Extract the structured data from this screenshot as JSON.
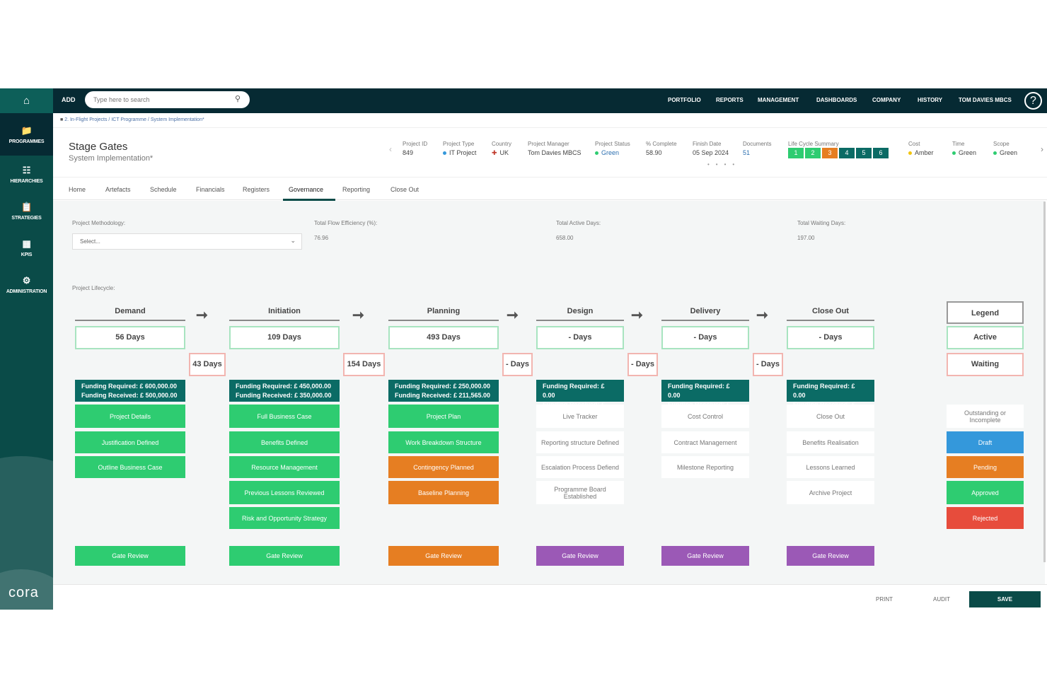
{
  "sidebar": {
    "home_icon": "home-icon",
    "logo": "cora",
    "items": [
      {
        "label": "PROGRAMMES",
        "icon": "folder-icon"
      },
      {
        "label": "HIERARCHIES",
        "icon": "hierarchy-icon"
      },
      {
        "label": "STRATEGIES",
        "icon": "clipboard-icon"
      },
      {
        "label": "KPIS",
        "icon": "bar-chart-icon"
      },
      {
        "label": "ADMINISTRATION",
        "icon": "gears-icon"
      }
    ]
  },
  "topbar": {
    "add": "ADD",
    "search_placeholder": "Type here to search",
    "nav": [
      "PORTFOLIO",
      "REPORTS",
      "MANAGEMENT",
      "DASHBOARDS",
      "COMPANY",
      "HISTORY",
      "TOM DAVIES MBCS"
    ],
    "help": "?"
  },
  "breadcrumb": "2. In-Flight Projects / ICT Programme / System Implementation*",
  "header": {
    "title": "Stage Gates",
    "subtitle": "System Implementation*"
  },
  "meta": [
    {
      "label": "Project ID",
      "value": "849"
    },
    {
      "label": "Project Type",
      "value": "IT Project",
      "dot": "#3498db"
    },
    {
      "label": "Country",
      "value": "UK",
      "flag": true
    },
    {
      "label": "Project Manager",
      "value": "Tom Davies MBCS"
    },
    {
      "label": "Project Status",
      "value": "Green",
      "dot": "#2ecc71"
    },
    {
      "label": "% Complete",
      "value": "58.90"
    },
    {
      "label": "Finish Date",
      "value": "05 Sep 2024"
    },
    {
      "label": "Documents",
      "value": "51"
    },
    {
      "label": "Life Cycle Summary",
      "lifecycle": [
        {
          "n": "1",
          "color": "#2ecc71"
        },
        {
          "n": "2",
          "color": "#2ecc71"
        },
        {
          "n": "3",
          "color": "#e67e22"
        },
        {
          "n": "4",
          "color": "#0b6b65"
        },
        {
          "n": "5",
          "color": "#0b6b65"
        },
        {
          "n": "6",
          "color": "#0b6b65"
        }
      ]
    },
    {
      "label": "Cost",
      "value": "Amber",
      "dot": "#f1c40f"
    },
    {
      "label": "Time",
      "value": "Green",
      "dot": "#2ecc71"
    },
    {
      "label": "Scope",
      "value": "Green",
      "dot": "#2ecc71"
    }
  ],
  "tabs": [
    "Home",
    "Artefacts",
    "Schedule",
    "Financials",
    "Registers",
    "Governance",
    "Reporting",
    "Close Out"
  ],
  "active_tab": "Governance",
  "fields": {
    "methodology_label": "Project Methodology:",
    "methodology_value": "Select...",
    "flow_label": "Total Flow Efficiency (%):",
    "flow_value": "76.96",
    "active_label": "Total Active Days:",
    "active_value": "658.00",
    "waiting_label": "Total Waiting Days:",
    "waiting_value": "197.00",
    "lifecycle_label": "Project Lifecycle:"
  },
  "stages": [
    {
      "name": "Demand",
      "days": "56 Days",
      "wait": "43 Days",
      "funding_required": "Funding Required: £ 600,000.00",
      "funding_received": "Funding Received: £ 500,000.00",
      "items": [
        {
          "label": "Project Details",
          "status": "g"
        },
        {
          "label": "Justification Defined",
          "status": "g"
        },
        {
          "label": "Outline Business Case",
          "status": "g"
        }
      ],
      "gate": {
        "label": "Gate Review",
        "status": "g"
      }
    },
    {
      "name": "Initiation",
      "days": "109 Days",
      "wait": "154 Days",
      "funding_required": "Funding Required: £ 450,000.00",
      "funding_received": "Funding Received: £ 350,000.00",
      "items": [
        {
          "label": "Full Business Case",
          "status": "g"
        },
        {
          "label": "Benefits Defined",
          "status": "g"
        },
        {
          "label": "Resource Management",
          "status": "g"
        },
        {
          "label": "Previous Lessons Reviewed",
          "status": "g"
        },
        {
          "label": "Risk and Opportunity Strategy",
          "status": "g"
        }
      ],
      "gate": {
        "label": "Gate Review",
        "status": "g"
      }
    },
    {
      "name": "Planning",
      "days": "493 Days",
      "wait": "- Days",
      "funding_required": "Funding Required: £ 250,000.00",
      "funding_received": "Funding Received: £ 211,565.00",
      "items": [
        {
          "label": "Project Plan",
          "status": "g"
        },
        {
          "label": "Work Breakdown Structure",
          "status": "g"
        },
        {
          "label": "Contingency Planned",
          "status": "o"
        },
        {
          "label": "Baseline Planning",
          "status": "o"
        }
      ],
      "gate": {
        "label": "Gate Review",
        "status": "o"
      }
    },
    {
      "name": "Design",
      "days": "- Days",
      "wait": "- Days",
      "funding_required": "Funding Required: £ 0.00",
      "funding_received": "Funding Received: £ 0.00",
      "items": [
        {
          "label": "Live Tracker",
          "status": "w"
        },
        {
          "label": "Reporting structure Defined",
          "status": "w"
        },
        {
          "label": "Escalation Process Defiend",
          "status": "w"
        },
        {
          "label": "Programme Board Established",
          "status": "w"
        }
      ],
      "gate": {
        "label": "Gate Review",
        "status": "p"
      }
    },
    {
      "name": "Delivery",
      "days": "- Days",
      "wait": "- Days",
      "funding_required": "Funding Required: £ 0.00",
      "funding_received": "Funding Received: £ 0.00",
      "items": [
        {
          "label": "Cost Control",
          "status": "w"
        },
        {
          "label": "Contract Management",
          "status": "w"
        },
        {
          "label": "Milestone Reporting",
          "status": "w"
        }
      ],
      "gate": {
        "label": "Gate Review",
        "status": "p"
      }
    },
    {
      "name": "Close Out",
      "days": "- Days",
      "funding_required": "Funding Required: £ 0.00",
      "funding_received": "Funding Received: £ 0.00",
      "items": [
        {
          "label": "Close Out",
          "status": "w"
        },
        {
          "label": "Benefits Realisation",
          "status": "w"
        },
        {
          "label": "Lessons Learned",
          "status": "w"
        },
        {
          "label": "Archive Project",
          "status": "w"
        }
      ],
      "gate": {
        "label": "Gate Review",
        "status": "p"
      }
    }
  ],
  "legend": {
    "title": "Legend",
    "active": "Active",
    "waiting": "Waiting",
    "items": [
      {
        "label": "Outstanding or Incomplete",
        "status": "w"
      },
      {
        "label": "Draft",
        "status": "b"
      },
      {
        "label": "Pending",
        "status": "o"
      },
      {
        "label": "Approved",
        "status": "g"
      },
      {
        "label": "Rejected",
        "status": "r"
      }
    ]
  },
  "footer": {
    "print": "PRINT",
    "audit": "AUDIT",
    "save": "SAVE"
  }
}
